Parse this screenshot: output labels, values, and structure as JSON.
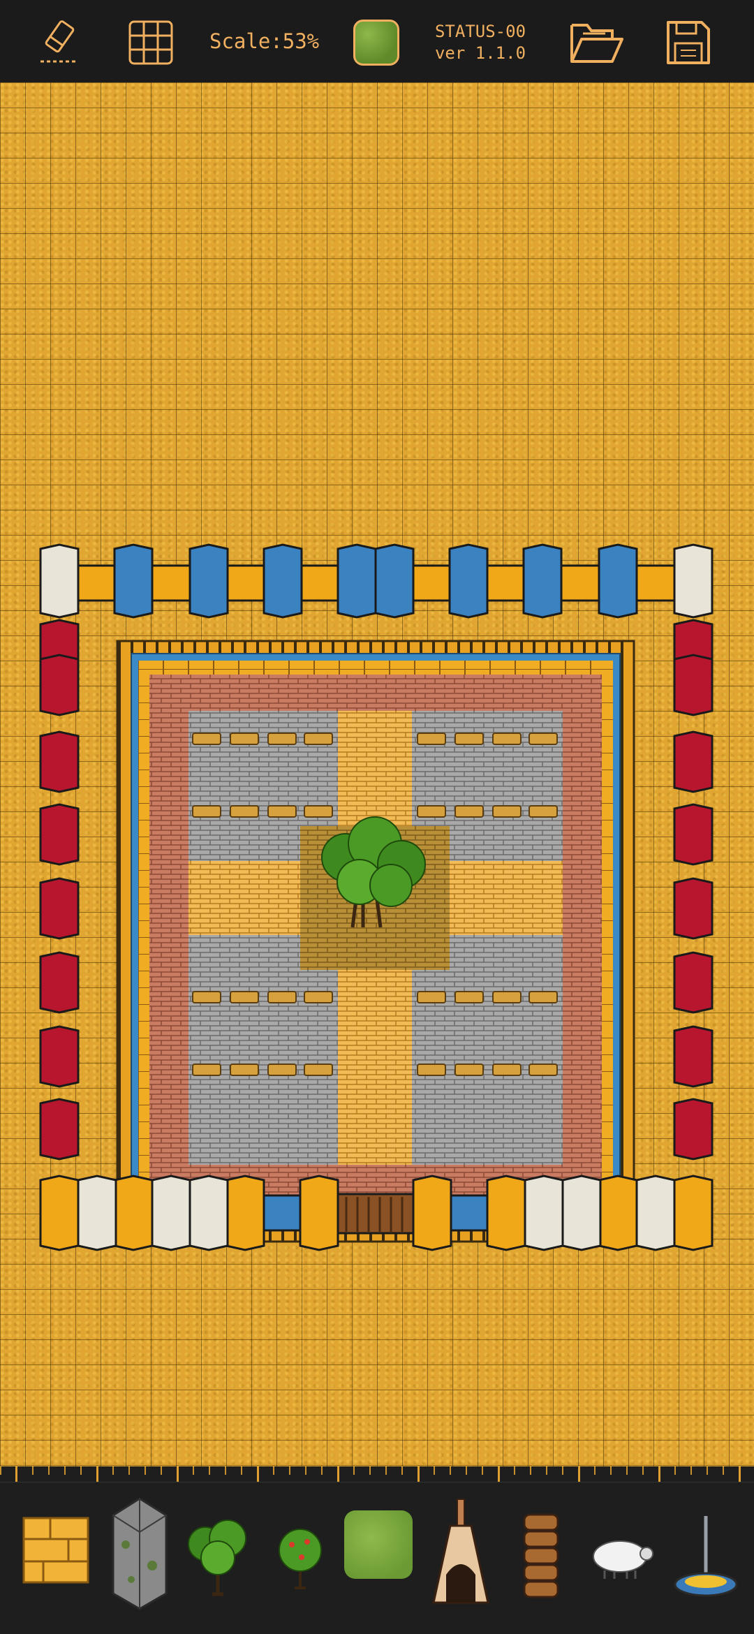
{
  "toolbar": {
    "scale_label": "Scale:53%",
    "status_line1": "STATUS-00",
    "status_line2": "ver 1.1.0"
  },
  "colors": {
    "accent": "#f0b060",
    "ground": "#e0a631",
    "topbar_bg": "#1b1b1b",
    "wall_blue": "#3a82c0",
    "wall_red": "#b8162e",
    "wall_white": "#e8e4d8",
    "wall_yellow": "#f0a818"
  },
  "palette": {
    "items": [
      "wood-plank-tile",
      "stone-pillar",
      "tree",
      "fruit-tree",
      "grass-tile",
      "bell-furnace",
      "barrel-stack",
      "sheep",
      "fountain"
    ]
  }
}
